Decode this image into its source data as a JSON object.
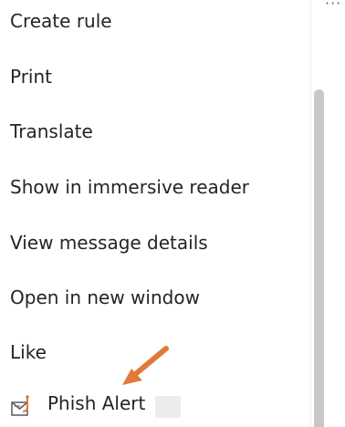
{
  "menu": {
    "items": [
      {
        "label": "Create rule"
      },
      {
        "label": "Print"
      },
      {
        "label": "Translate"
      },
      {
        "label": "Show in immersive reader"
      },
      {
        "label": "View message details"
      },
      {
        "label": "Open in new window"
      },
      {
        "label": "Like"
      }
    ],
    "phish_alert": {
      "label": "Phish Alert",
      "icon": "phish-alert-icon"
    }
  },
  "toolbar": {
    "more_icon": "more-icon",
    "more_glyph": "···"
  },
  "annotation": {
    "arrow_color": "#e07a3a"
  }
}
